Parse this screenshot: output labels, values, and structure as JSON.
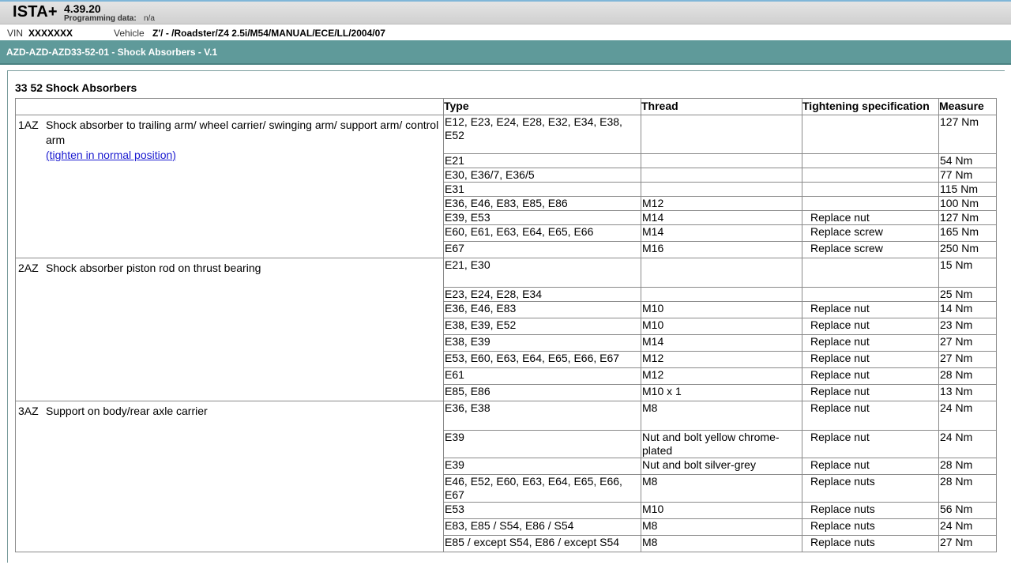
{
  "header": {
    "app_name": "ISTA+",
    "version": "4.39.20",
    "programming_label": "Programming data:",
    "programming_value": "n/a"
  },
  "vehicle_bar": {
    "vin_label": "VIN",
    "vin_value": "XXXXXXX",
    "vehicle_label": "Vehicle",
    "vehicle_value": "Z'/ - /Roadster/Z4 2.5i/M54/MANUAL/ECE/LL/2004/07"
  },
  "title_bar": {
    "title": "AZD-AZD-AZD33-52-01 - Shock Absorbers - V.1"
  },
  "document": {
    "section_title": "33 52 Shock Absorbers",
    "columns": [
      "Type",
      "Thread",
      "Tightening specification",
      "Measure"
    ],
    "groups": [
      {
        "code": "1AZ",
        "description": "Shock absorber to trailing arm/ wheel carrier/ swinging arm/ support arm/ control arm",
        "link": "(tighten in normal position)",
        "rows": [
          {
            "type": "E12, E23, E24, E28, E32, E34, E38, E52",
            "thread": "",
            "spec": "",
            "measure": "127 Nm"
          },
          {
            "type": "E21",
            "thread": "",
            "spec": "",
            "measure": "54 Nm"
          },
          {
            "type": "E30, E36/7, E36/5",
            "thread": "",
            "spec": "",
            "measure": "77 Nm"
          },
          {
            "type": "E31",
            "thread": "",
            "spec": "",
            "measure": "115 Nm"
          },
          {
            "type": "E36, E46, E83, E85, E86",
            "thread": "M12",
            "spec": "",
            "measure": "100 Nm"
          },
          {
            "type": "E39, E53",
            "thread": "M14",
            "spec": "Replace nut",
            "measure": "127 Nm"
          },
          {
            "type": "E60, E61, E63, E64, E65, E66",
            "thread": "M14",
            "spec": "Replace screw",
            "measure": "165 Nm"
          },
          {
            "type": "E67",
            "thread": "M16",
            "spec": "Replace screw",
            "measure": "250 Nm"
          }
        ]
      },
      {
        "code": "2AZ",
        "description": "Shock absorber piston rod on thrust bearing",
        "link": "",
        "rows": [
          {
            "type": "E21, E30",
            "thread": "",
            "spec": "",
            "measure": "15 Nm"
          },
          {
            "type": "E23, E24, E28, E34",
            "thread": "",
            "spec": "",
            "measure": "25 Nm"
          },
          {
            "type": "E36, E46, E83",
            "thread": "M10",
            "spec": "Replace nut",
            "measure": "14 Nm"
          },
          {
            "type": "E38, E39, E52",
            "thread": "M10",
            "spec": "Replace nut",
            "measure": "23 Nm"
          },
          {
            "type": "E38, E39",
            "thread": "M14",
            "spec": "Replace nut",
            "measure": "27 Nm"
          },
          {
            "type": "E53, E60, E63, E64, E65, E66, E67",
            "thread": "M12",
            "spec": "Replace nut",
            "measure": "27 Nm"
          },
          {
            "type": "E61",
            "thread": "M12",
            "spec": "Replace nut",
            "measure": "28 Nm"
          },
          {
            "type": "E85, E86",
            "thread": "M10 x 1",
            "spec": "Replace nut",
            "measure": "13 Nm"
          }
        ]
      },
      {
        "code": "3AZ",
        "description": "Support on body/rear axle carrier",
        "link": "",
        "rows": [
          {
            "type": "E36, E38",
            "thread": "M8",
            "spec": "Replace nut",
            "measure": "24 Nm"
          },
          {
            "type": "E39",
            "thread": "Nut and bolt yellow chrome-plated",
            "spec": "Replace nut",
            "measure": "24 Nm"
          },
          {
            "type": "E39",
            "thread": "Nut and bolt silver-grey",
            "spec": "Replace nut",
            "measure": "28 Nm"
          },
          {
            "type": "E46, E52, E60, E63, E64, E65, E66, E67",
            "thread": "M8",
            "spec": "Replace nuts",
            "measure": "28 Nm"
          },
          {
            "type": "E53",
            "thread": "M10",
            "spec": "Replace nuts",
            "measure": "56 Nm"
          },
          {
            "type": "E83, E85 / S54, E86 / S54",
            "thread": "M8",
            "spec": "Replace nuts",
            "measure": "24 Nm"
          },
          {
            "type": "E85 / except S54, E86 / except S54",
            "thread": "M8",
            "spec": "Replace nuts",
            "measure": "27 Nm"
          }
        ]
      }
    ]
  },
  "colors": {
    "title_bar_bg": "#5f9a9a",
    "link": "#1a1ad0"
  }
}
